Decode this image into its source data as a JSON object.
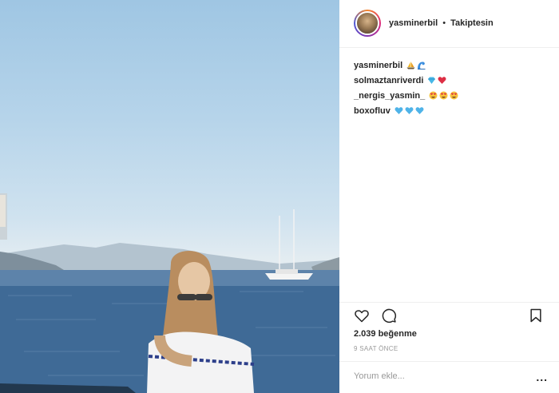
{
  "photo": {
    "alt": ""
  },
  "header": {
    "username": "yasminerbil",
    "separator": "•",
    "follow_status": "Takiptesin"
  },
  "comments": [
    {
      "user": "yasminerbil",
      "emojis": [
        "sailboat-emoji",
        "wave-emoji"
      ]
    },
    {
      "user": "solmaztanriverdi",
      "emojis": [
        "gem-emoji",
        "red-heart-emoji"
      ]
    },
    {
      "user": "_nergis_yasmin_",
      "emojis": [
        "heart-eyes-emoji",
        "heart-eyes-emoji",
        "heart-eyes-emoji"
      ]
    },
    {
      "user": "boxofluv",
      "emojis": [
        "blue-heart-emoji",
        "blue-heart-emoji",
        "blue-heart-emoji"
      ]
    }
  ],
  "likes": "2.039 beğenme",
  "time": "9 SAAT ÖNCE",
  "add_comment": {
    "placeholder": "Yorum ekle..."
  },
  "more_label": "..."
}
